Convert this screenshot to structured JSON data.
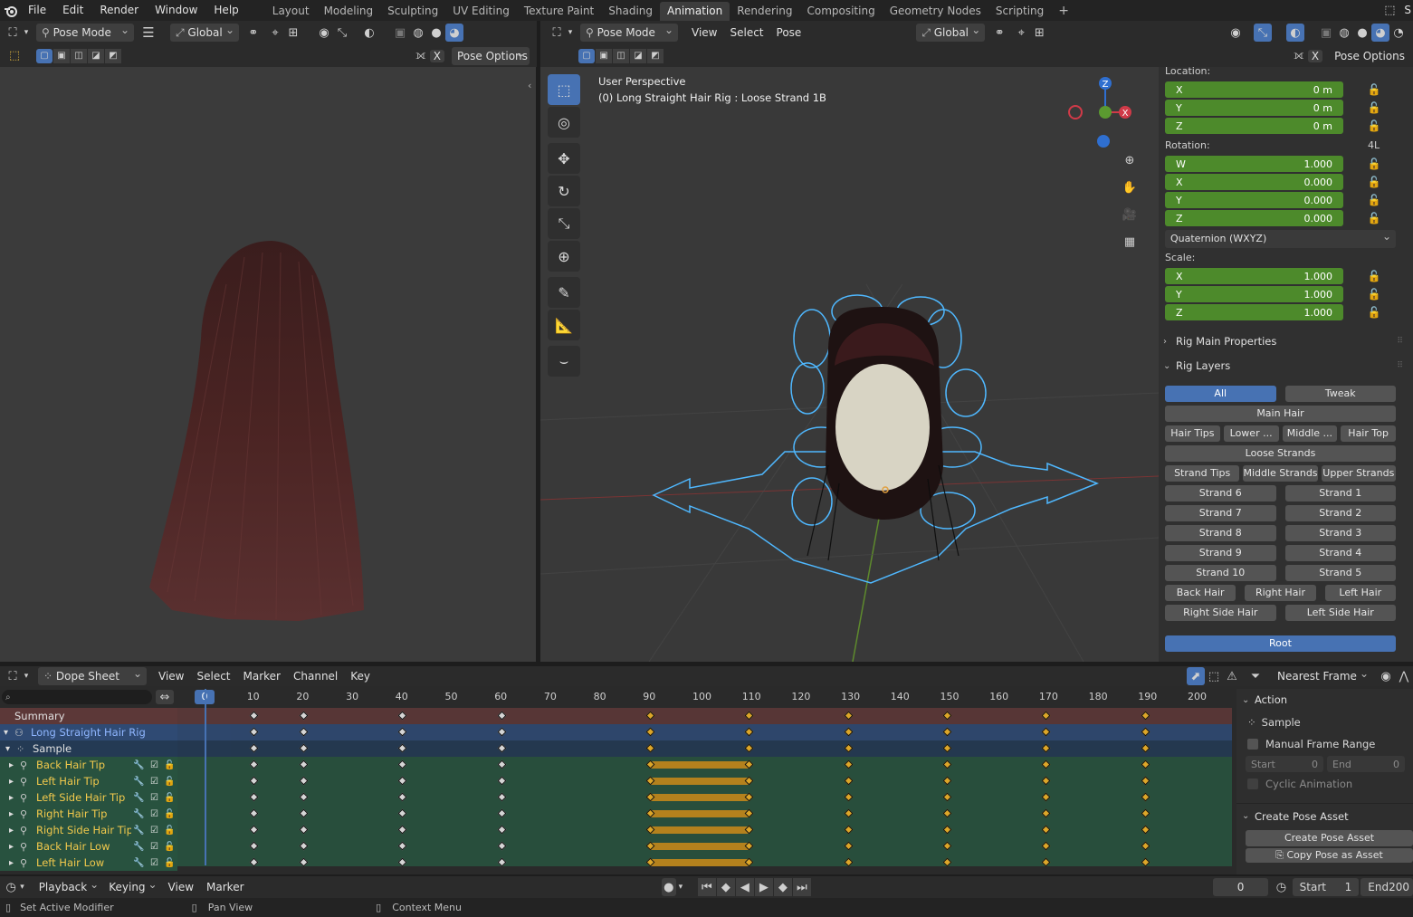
{
  "menubar": {
    "menus": [
      "File",
      "Edit",
      "Render",
      "Window",
      "Help"
    ],
    "workspaces": [
      "Layout",
      "Modeling",
      "Sculpting",
      "UV Editing",
      "Texture Paint",
      "Shading",
      "Animation",
      "Rendering",
      "Compositing",
      "Geometry Nodes",
      "Scripting"
    ],
    "active_workspace": "Animation",
    "add_label": "+",
    "scene_initial": "S"
  },
  "left_view": {
    "mode": "Pose Mode",
    "orientation": "Global",
    "pose_options": "Pose Options",
    "x_label": "X"
  },
  "right_view": {
    "mode": "Pose Mode",
    "menus": [
      "View",
      "Select",
      "Pose"
    ],
    "orientation": "Global",
    "pose_options": "Pose Options",
    "x_label": "X",
    "overlay_title": "User Perspective",
    "overlay_subtitle": "(0) Long Straight Hair Rig : Loose Strand 1B",
    "gizmo_z": "Z",
    "gizmo_x": "X"
  },
  "transform": {
    "location_label": "Location:",
    "location": [
      {
        "axis": "X",
        "value": "0 m"
      },
      {
        "axis": "Y",
        "value": "0 m"
      },
      {
        "axis": "Z",
        "value": "0 m"
      }
    ],
    "rotation_label": "Rotation:",
    "rotation_mode_tag": "4L",
    "rotation": [
      {
        "axis": "W",
        "value": "1.000"
      },
      {
        "axis": "X",
        "value": "0.000"
      },
      {
        "axis": "Y",
        "value": "0.000"
      },
      {
        "axis": "Z",
        "value": "0.000"
      }
    ],
    "rotation_mode": "Quaternion (WXYZ)",
    "scale_label": "Scale:",
    "scale": [
      {
        "axis": "X",
        "value": "1.000"
      },
      {
        "axis": "Y",
        "value": "1.000"
      },
      {
        "axis": "Z",
        "value": "1.000"
      }
    ]
  },
  "rig": {
    "main_properties": "Rig Main Properties",
    "layers_title": "Rig Layers",
    "all": "All",
    "tweak": "Tweak",
    "main_hair": "Main Hair",
    "row_tips": [
      "Hair Tips",
      "Lower ...",
      "Middle ...",
      "Hair Top"
    ],
    "loose_strands": "Loose Strands",
    "row_strands": [
      "Strand Tips",
      "Middle Strands",
      "Upper Strands"
    ],
    "strand_pairs": [
      [
        "Strand 6",
        "Strand 1"
      ],
      [
        "Strand 7",
        "Strand 2"
      ],
      [
        "Strand 8",
        "Strand 3"
      ],
      [
        "Strand 9",
        "Strand 4"
      ],
      [
        "Strand 10",
        "Strand 5"
      ]
    ],
    "row_hair": [
      "Back Hair",
      "Right Hair",
      "Left Hair"
    ],
    "row_side": [
      "Right Side Hair",
      "Left Side Hair"
    ],
    "root": "Root"
  },
  "dopesheet": {
    "editor": "Dope Sheet",
    "menus": [
      "View",
      "Select",
      "Marker",
      "Channel",
      "Key"
    ],
    "snap": "Nearest Frame",
    "current_frame": "0",
    "ruler": [
      "10",
      "20",
      "30",
      "40",
      "50",
      "60",
      "70",
      "80",
      "90",
      "100",
      "110",
      "120",
      "130",
      "140",
      "150",
      "160",
      "170",
      "180",
      "190",
      "200"
    ],
    "keyframes": [
      10,
      20,
      40,
      60,
      90,
      110,
      130,
      150,
      170,
      190
    ],
    "hold_start": 90,
    "hold_end": 110,
    "channels": [
      {
        "name": "Summary",
        "kind": "summary"
      },
      {
        "name": "Long Straight Hair Rig",
        "kind": "object"
      },
      {
        "name": "Sample",
        "kind": "action"
      },
      {
        "name": "Back Hair Tip",
        "kind": "bone"
      },
      {
        "name": "Left Hair Tip",
        "kind": "bone"
      },
      {
        "name": "Left Side Hair Tip",
        "kind": "bone"
      },
      {
        "name": "Right Hair Tip",
        "kind": "bone"
      },
      {
        "name": "Right Side Hair Tip",
        "kind": "bone"
      },
      {
        "name": "Back Hair Low",
        "kind": "bone"
      },
      {
        "name": "Left Hair Low",
        "kind": "bone"
      }
    ]
  },
  "action_panel": {
    "title": "Action",
    "action_name": "Sample",
    "manual_range": "Manual Frame Range",
    "start_label": "Start",
    "start_value": "0",
    "end_label": "End",
    "end_value": "0",
    "cyclic": "Cyclic Animation",
    "pose_asset_title": "Create Pose Asset",
    "create_pose_asset": "Create Pose Asset",
    "copy_pose_asset": "Copy Pose as Asset"
  },
  "timeline": {
    "menus": [
      "Playback",
      "Keying",
      "View",
      "Marker"
    ],
    "frame": "0",
    "start_label": "Start",
    "start_value": "1",
    "end_label": "End",
    "end_value": "200"
  },
  "status": {
    "left": "Set Active Modifier",
    "middle": "Pan View",
    "right": "Context Menu"
  },
  "colors": {
    "accent": "#4772b3",
    "green_field": "#4d8a2b",
    "keyframe_orange": "#f0b429",
    "hold_bar": "#c48b1c",
    "bone_text": "#f2c94c",
    "summary_row": "#5c3838",
    "object_row": "#2f4a73",
    "action_row": "#243a54",
    "bone_row": "#28523f"
  }
}
